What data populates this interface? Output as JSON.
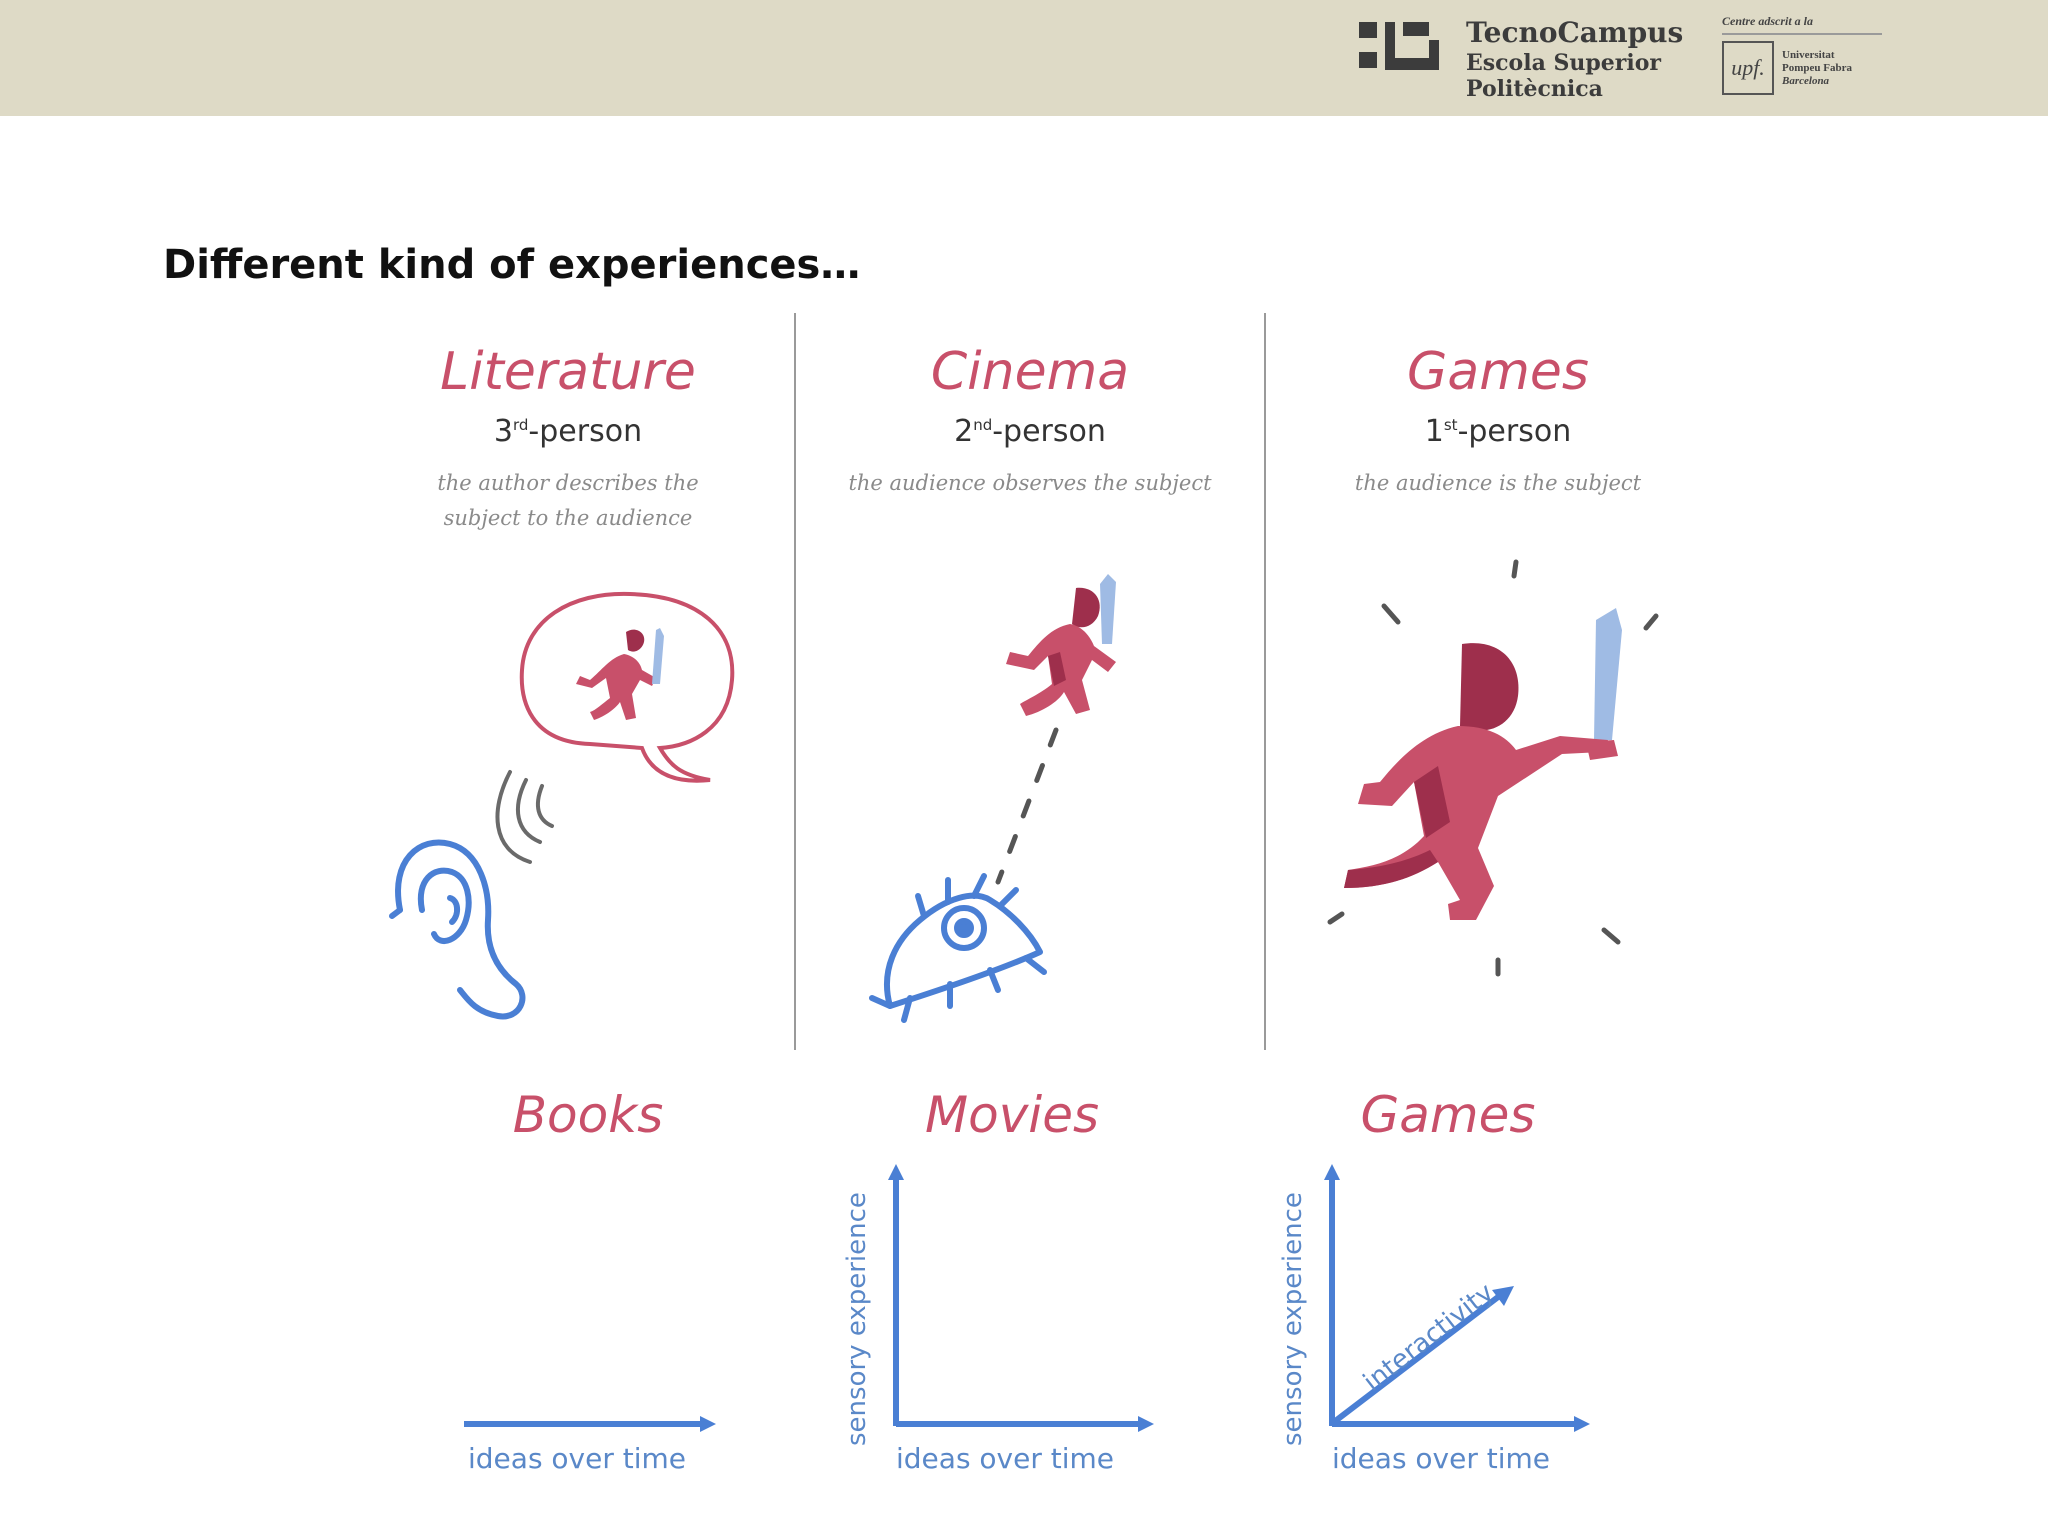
{
  "header": {
    "tecnocampus": {
      "name": "TecnoCampus",
      "line2": "Escola Superior",
      "line3": "Politècnica"
    },
    "upf": {
      "tag": "Centre adscrit a la",
      "mark": "upf.",
      "line1": "Universitat",
      "line2": "Pompeu Fabra",
      "line3": "Barcelona"
    }
  },
  "slide": {
    "title": "Different kind of experiences…"
  },
  "columns": [
    {
      "title": "Literature",
      "ordinal": "3",
      "suffix": "rd",
      "person": "-person",
      "desc1": "the author describes the",
      "desc2": "subject to the audience"
    },
    {
      "title": "Cinema",
      "ordinal": "2",
      "suffix": "nd",
      "person": "-person",
      "desc1": "the audience observes the subject",
      "desc2": ""
    },
    {
      "title": "Games",
      "ordinal": "1",
      "suffix": "st",
      "person": "-person",
      "desc1": "the audience is the subject",
      "desc2": ""
    }
  ],
  "media": [
    {
      "title": "Books",
      "xlabel": "ideas over time"
    },
    {
      "title": "Movies",
      "xlabel": "ideas over time",
      "ylabel": "sensory experience"
    },
    {
      "title": "Games",
      "xlabel": "ideas over time",
      "ylabel": "sensory experience",
      "diagonal": "interactivity"
    }
  ],
  "colors": {
    "accent": "#c8506a",
    "figure_dark": "#9e2f4c",
    "figure_light": "#d65672",
    "blue": "#4a7fd4",
    "header_bg": "#dedac6"
  },
  "icons": [
    "ear-icon",
    "speech-bubble-icon",
    "sound-waves-icon",
    "eye-icon",
    "runner-with-sword-icon"
  ]
}
